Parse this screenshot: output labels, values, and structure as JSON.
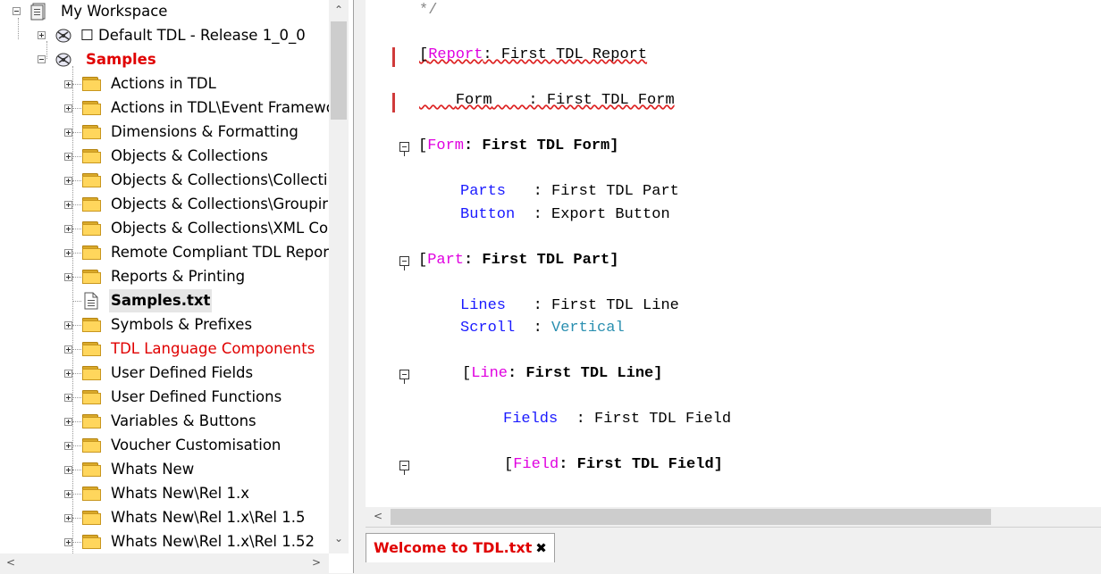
{
  "tree": {
    "root_label": "My Workspace",
    "release_label": "☐ Default TDL - Release 1_0_0",
    "samples_label": "Samples",
    "items": [
      {
        "label": "Actions in TDL",
        "type": "folder"
      },
      {
        "label": "Actions in TDL\\Event Framewo",
        "type": "folder"
      },
      {
        "label": "Dimensions & Formatting",
        "type": "folder"
      },
      {
        "label": "Objects & Collections",
        "type": "folder"
      },
      {
        "label": "Objects & Collections\\Collecti",
        "type": "folder"
      },
      {
        "label": "Objects & Collections\\Groupir",
        "type": "folder"
      },
      {
        "label": "Objects & Collections\\XML Co",
        "type": "folder"
      },
      {
        "label": "Remote Compliant TDL Report",
        "type": "folder"
      },
      {
        "label": "Reports & Printing",
        "type": "folder"
      },
      {
        "label": "Samples.txt",
        "type": "file"
      },
      {
        "label": "Symbols & Prefixes",
        "type": "folder"
      },
      {
        "label": "TDL Language Components",
        "type": "folder",
        "highlight": true
      },
      {
        "label": "User Defined Fields",
        "type": "folder"
      },
      {
        "label": "User Defined Functions",
        "type": "folder"
      },
      {
        "label": "Variables & Buttons",
        "type": "folder"
      },
      {
        "label": "Voucher Customisation",
        "type": "folder"
      },
      {
        "label": "Whats New",
        "type": "folder"
      },
      {
        "label": "Whats New\\Rel 1.x",
        "type": "folder"
      },
      {
        "label": "Whats New\\Rel 1.x\\Rel 1.5",
        "type": "folder"
      },
      {
        "label": "Whats New\\Rel 1.x\\Rel 1.52",
        "type": "folder"
      }
    ]
  },
  "editor": {
    "comment_end": "*/",
    "line1_bracket": "[",
    "line1_kw": "Report",
    "line1_rest": ": First TDL Report",
    "line2_attr": "Form",
    "line2_rest": "    : First TDL Form",
    "form_open": "[",
    "form_kw": "Form",
    "form_rest": ": First TDL Form]",
    "parts_attr": "Parts",
    "parts_val": "   : First TDL Part",
    "button_attr": "Button",
    "button_val": "  : Export Button",
    "part_open": "[",
    "part_kw": "Part",
    "part_rest": ": First TDL Part]",
    "lines_attr": "Lines",
    "lines_val": "   : First TDL Line",
    "scroll_attr": "Scroll",
    "scroll_sep": "  : ",
    "scroll_val": "Vertical",
    "line_open": "[",
    "line_kw": "Line",
    "line_rest": ": First TDL Line]",
    "fields_attr": "Fields",
    "fields_val": "  : First TDL Field",
    "field_open": "[",
    "field_kw": "Field",
    "field_rest": ": First TDL Field]"
  },
  "tabs": [
    {
      "label": "Welcome to TDL.txt",
      "close": "✖"
    }
  ],
  "colors": {
    "keyword": "#e000e0",
    "attribute": "#1a1aff",
    "highlight": "#e00000"
  }
}
